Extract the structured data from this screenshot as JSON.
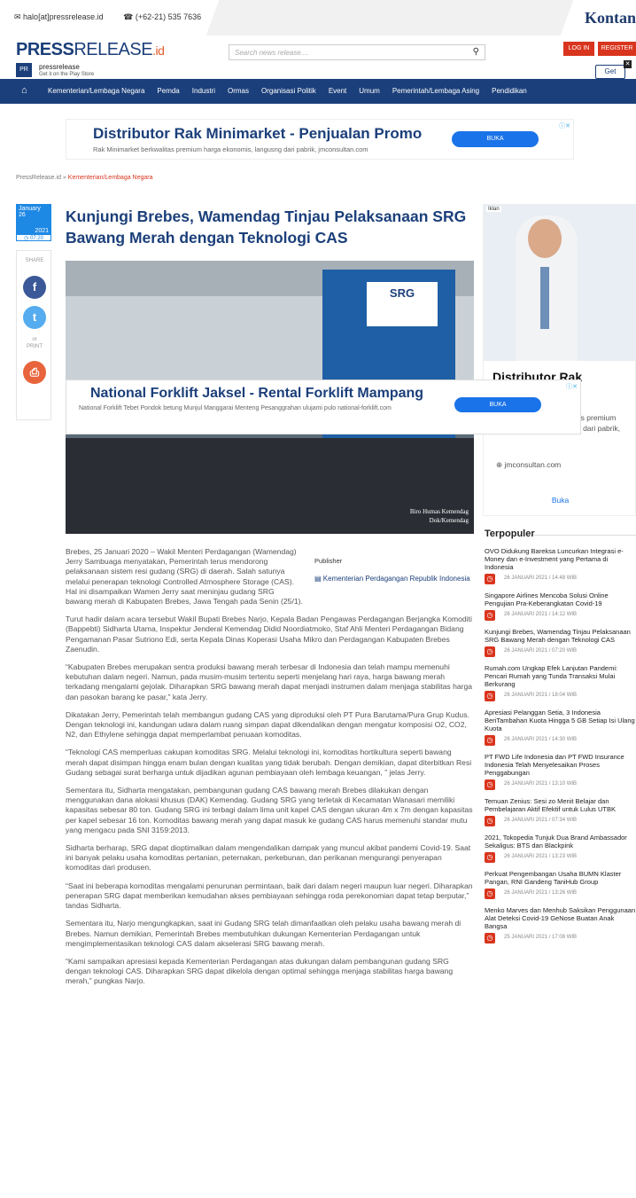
{
  "topbar": {
    "email": "halo[at]pressrelease.id",
    "phone": "(+62-21) 535 7636",
    "partner": "Kontan"
  },
  "header": {
    "logo_bold": "PRESS",
    "logo_thin": "RELEASE",
    "logo_id": ".id",
    "search_placeholder": "Search news release....",
    "login": "LOG IN",
    "register": "REGISTER"
  },
  "appbanner": {
    "icon": "PR",
    "title": "pressrelease",
    "subtitle": "Get it on the Play Store",
    "button": "Get"
  },
  "nav": {
    "items": [
      "Kementerian/Lembaga Negara",
      "Pemda",
      "Industri",
      "Ormas",
      "Organisasi Politik",
      "Event",
      "Umum",
      "Pemerintah/Lembaga Asing",
      "Pendidikan"
    ]
  },
  "ad_top": {
    "headline": "Distributor Rak Minimarket - Penjualan Promo",
    "sub": "Rak Minimarket berkwalitas premium harga ekonomis, langusng dari pabrik, jmconsultan.com",
    "button": "BUKA"
  },
  "breadcrumb": {
    "home": "PressRelease.id",
    "sep": "»",
    "current": "Kementerian/Lembaga Negara"
  },
  "date": {
    "month": "January",
    "day": "26",
    "year": "2021",
    "time": "07:20"
  },
  "share": {
    "label": "SHARE",
    "or": "or",
    "print": "PRINT"
  },
  "article": {
    "title": "Kunjungi Brebes, Wamendag Tinjau Pelaksanaan SRG Bawang Merah dengan Teknologi CAS",
    "photo_sign": "SRG",
    "photo_caption_1": "Biro Humas Kemendag",
    "photo_caption_2": "Dok/Kemendag",
    "publisher_label": "Publisher",
    "publisher_name": "Kementerian Perdagangan Republik Indonesia",
    "paragraphs": [
      "Brebes, 25 Januari 2020 – Wakil Menteri Perdagangan (Wamendag) Jerry Sambuaga menyatakan, Pemerintah terus mendorong pelaksanaan sistem resi gudang (SRG) di daerah. Salah satunya melalui penerapan teknologi Controlled Atmosphere Storage (CAS). Hal ini disampaikan Wamen Jerry saat meninjau gudang SRG bawang merah di Kabupaten Brebes, Jawa Tengah pada Senin (25/1).",
      "Turut hadir dalam acara tersebut Wakil Bupati Brebes Narjo, Kepala Badan Pengawas Perdagangan Berjangka Komoditi (Bappebti) Sidharta Utama, Inspektur Jenderal Kemendag Didid Noordiatmoko, Staf Ahli Menteri Perdagangan Bidang Pengamanan Pasar Sutriono Edi, serta Kepala Dinas Koperasi Usaha Mikro dan Perdagangan Kabupaten Brebes Zaenudin.",
      "“Kabupaten Brebes merupakan sentra produksi bawang merah terbesar di Indonesia dan telah mampu memenuhi kebutuhan dalam negeri. Namun, pada musim-musim tertentu seperti menjelang hari raya, harga bawang merah terkadang mengalami gejolak. Diharapkan SRG bawang merah dapat menjadi instrumen dalam menjaga stabilitas harga dan pasokan barang ke pasar,” kata Jerry.",
      "Dikatakan Jerry, Pemerintah telah membangun gudang CAS yang diproduksi oleh PT Pura Barutama/Pura Grup Kudus. Dengan teknologi ini, kandungan udara dalam ruang simpan dapat dikendalikan dengan mengatur komposisi O2, CO2, N2, dan Ethylene sehingga dapat memperlambat penuaan komoditas.",
      "“Teknologi CAS memperluas cakupan komoditas SRG. Melalui teknologi ini, komoditas hortikultura seperti bawang merah dapat disimpan hingga enam bulan dengan kualitas yang tidak berubah. Dengan demikian, dapat diterbitkan Resi Gudang sebagai surat berharga untuk dijadikan agunan pembiayaan oleh lembaga keuangan, ” jelas Jerry.",
      "Sementara itu, Sidharta mengatakan, pembangunan gudang CAS bawang merah Brebes dilakukan dengan menggunakan dana alokasi khusus (DAK) Kemendag. Gudang SRG yang terletak di Kecamatan Wanasari memiliki kapasitas sebesar 80 ton. Gudang SRG ini terbagi dalam lima unit kapel CAS dengan ukuran 4m x 7m dengan kapasitas per kapel sebesar 16 ton. Komoditas bawang merah yang dapat masuk ke gudang CAS harus memenuhi standar mutu yang mengacu pada SNI 3159:2013.",
      "Sidharta berharap, SRG dapat dioptimalkan dalam mengendalikan dampak yang muncul akibat pandemi Covid-19. Saat ini banyak pelaku usaha komoditas pertanian, peternakan, perkebunan, dan perikanan mengurangi penyerapan komoditas dari produsen.",
      "“Saat ini beberapa komoditas mengalami penurunan permintaan, baik dari dalam negeri maupun luar negeri. Diharapkan penerapan SRG dapat memberikan kemudahan akses pembiayaan sehingga roda perekonomian dapat tetap berputar,” tandas Sidharta.",
      "Sementara itu, Narjo mengungkapkan, saat ini Gudang SRG telah dimanfaatkan oleh pelaku usaha bawang merah di Brebes. Namun demikian, Pemerintah Brebes membutuhkan dukungan Kementerian Perdagangan untuk mengimplementasikan teknologi CAS dalam akselerasi SRG bawang merah.",
      "“Kami sampaikan apresiasi kepada Kementerian Perdagangan atas dukungan dalam pembangunan gudang SRG dengan teknologi CAS. Diharapkan SRG dapat dikelola dengan optimal sehingga menjaga stabilitas harga bawang merah,” pungkas Narjo."
    ]
  },
  "ad_overlay": {
    "headline": "National Forklift Jaksel - Rental Forklift Mampang",
    "sub": "National Forklift Tebet Pondok betung Munjul Manggarai Menteng Pesanggrahan ulujami pulo national-forklift.com",
    "button": "BUKA"
  },
  "side_ad": {
    "label": "Iklan",
    "headline": "Distributor Rak",
    "desc": "Rak Minimarket berkwalitas premium harga ekonomis, langusng dari pabrik,",
    "url": "jmconsultan.com",
    "button": "Buka"
  },
  "popular": {
    "title": "Terpopuler",
    "items": [
      {
        "title": "OVO Didukung Bareksa Luncurkan Integrasi e-Money dan e-Investment yang Pertama di Indonesia",
        "date": "26 JANUARI 2021 / 14:48 WIB"
      },
      {
        "title": "Singapore Airlines Mencoba Solusi Online Pengujian Pra-Keberangkatan Covid-19",
        "date": "26 JANUARI 2021 / 14:12 WIB"
      },
      {
        "title": "Kunjungi Brebes, Wamendag Tinjau Pelaksanaan SRG Bawang Merah dengan Teknologi CAS",
        "date": "26 JANUARI 2021 / 07:20 WIB"
      },
      {
        "title": "Rumah.com Ungkap Efek Lanjutan Pandemi: Pencari Rumah yang Tunda Transaksi Mulai Berkurang",
        "date": "26 JANUARI 2021 / 18:04 WIB"
      },
      {
        "title": "Apresiasi Pelanggan Setia, 3 Indonesia BeriTambahan Kuota Hingga 5 GB Setiap Isi Ulang Kuota",
        "date": "26 JANUARI 2021 / 14:30 WIB"
      },
      {
        "title": "PT FWD Life Indonesia dan PT FWD Insurance Indonesia Telah Menyelesaikan Proses Penggabungan",
        "date": "26 JANUARI 2021 / 13:10 WIB"
      },
      {
        "title": "Temuan Zenius: Sesi zo Menit Belajar dan Pembelajaran Aktif Efektif untuk Lulus UTBK",
        "date": "26 JANUARI 2021 / 07:34 WIB"
      },
      {
        "title": "2021, Tokopedia Tunjuk Dua Brand Ambassador Sekaligus: BTS dan Blackpink",
        "date": "26 JANUARI 2021 / 13:23 WIB"
      },
      {
        "title": "Perkuat Pengembangan Usaha BUMN Klaster Pangan, RNI Gandeng TaniHub Group",
        "date": "26 JANUARI 2021 / 13:26 WIB"
      },
      {
        "title": "Menko Marves dan Menhub Saksikan Penggunaan Alat Deteksi Covid-19 GeNose Buatan Anak Bangsa",
        "date": "25 JANUARI 2021 / 17:08 WIB"
      }
    ]
  }
}
